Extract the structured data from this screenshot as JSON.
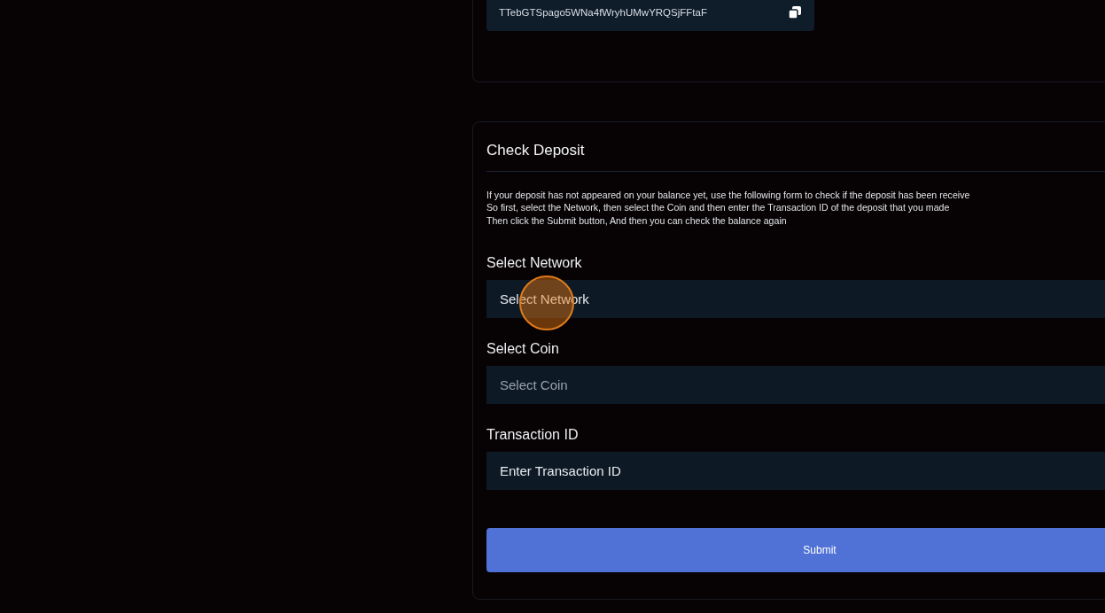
{
  "wallet_card": {
    "address": "TTebGTSpago5WNa4fWryhUMwYRQSjFFtaF"
  },
  "check_deposit": {
    "title": "Check Deposit",
    "instructions": [
      "If your deposit has not appeared on your balance yet, use the following form to check if the deposit has been receive",
      "So first, select the Network, then select the Coin and then enter the Transaction ID of the deposit that you made",
      "Then click the Submit button, And then you can check the balance again"
    ],
    "fields": [
      {
        "label": "Select Network",
        "value": "Select Network"
      },
      {
        "label": "Select Coin",
        "placeholder": "Select Coin"
      },
      {
        "label": "Transaction ID",
        "value": "Enter Transaction ID"
      }
    ],
    "submit": "Submit"
  }
}
